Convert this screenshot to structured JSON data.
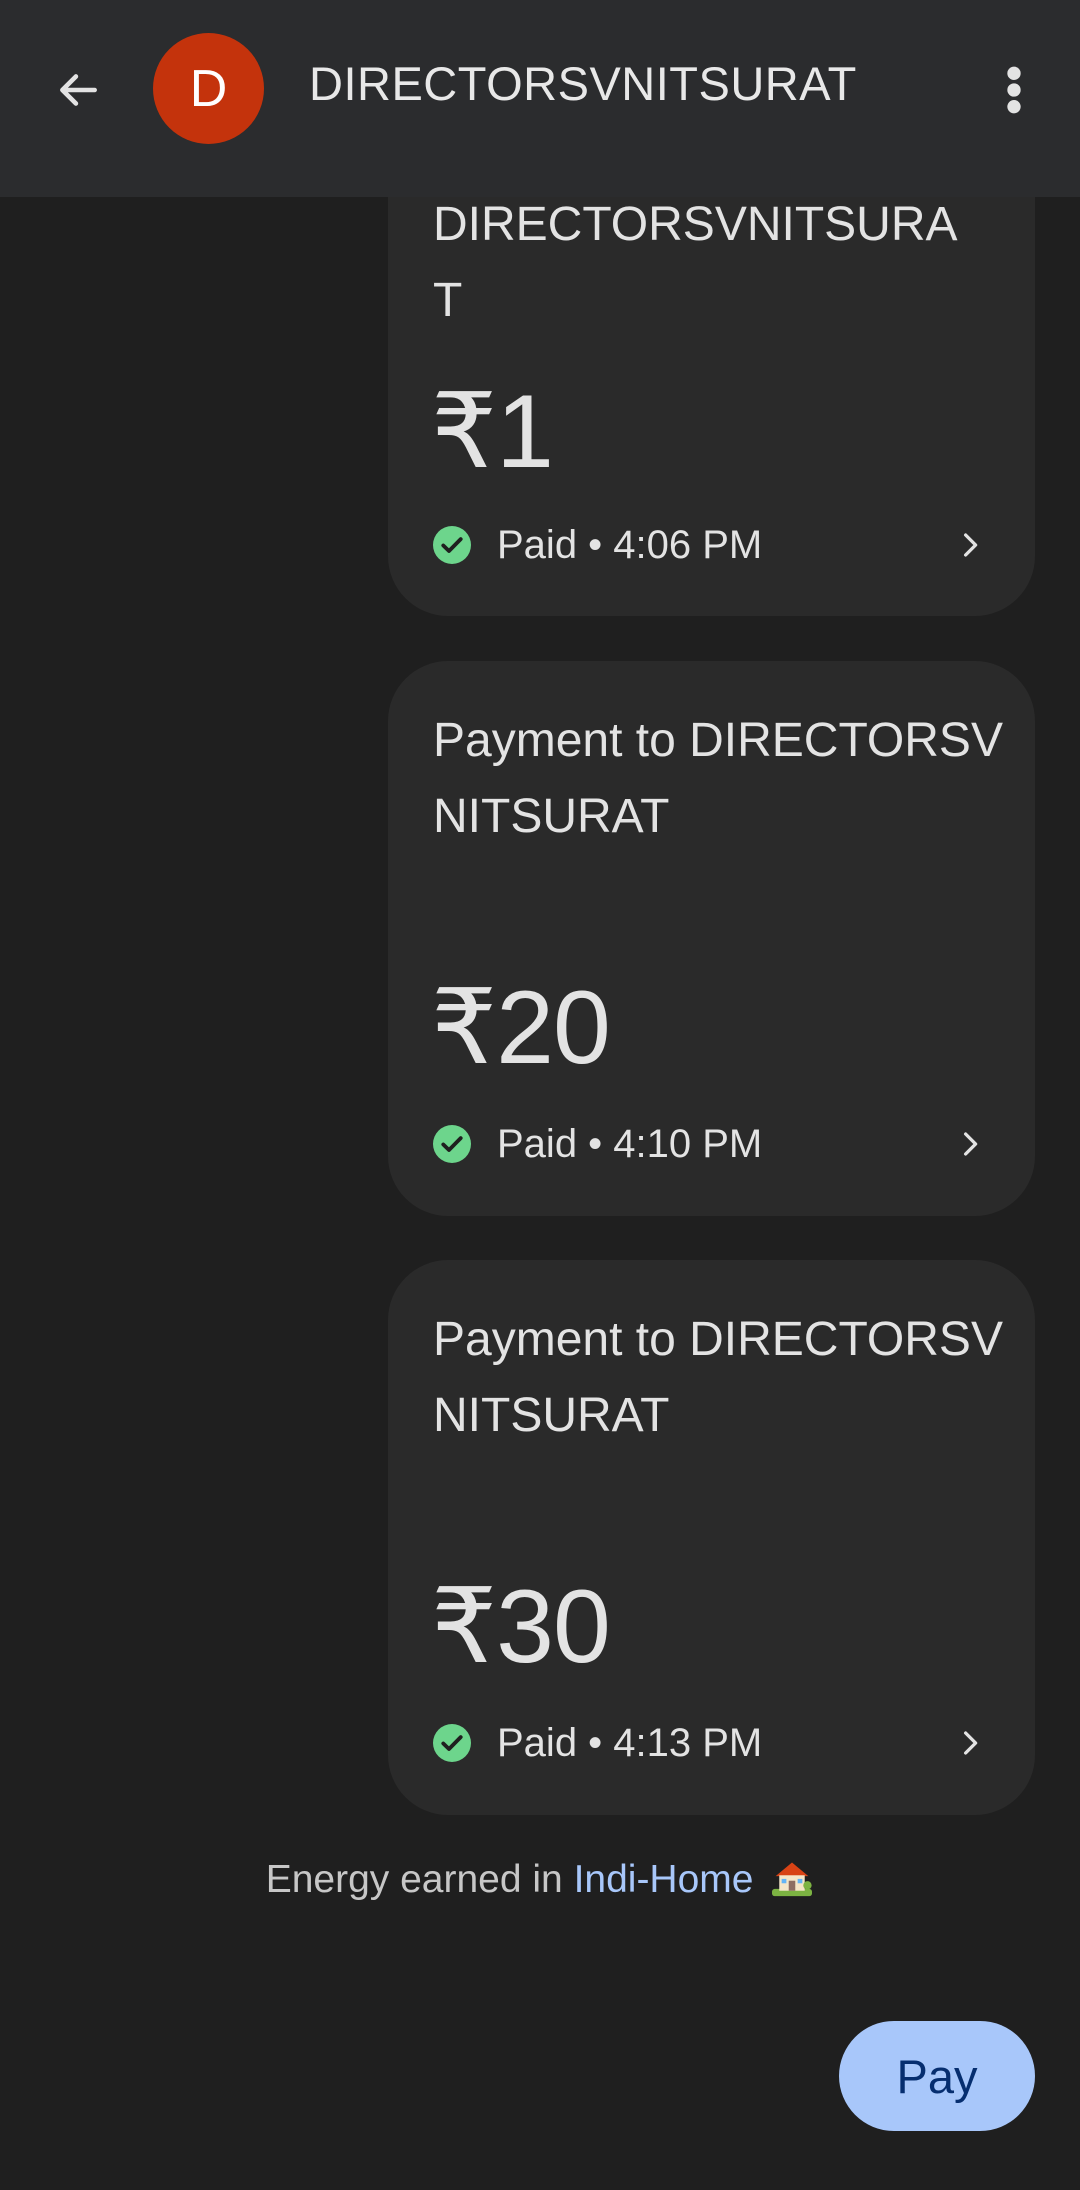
{
  "header": {
    "back_icon": "arrow-back-icon",
    "avatar_letter": "D",
    "avatar_color": "#c4330c",
    "title": "DIRECTORSVNITSURAT",
    "more_icon": "more-vert-icon"
  },
  "payments": [
    {
      "title_visible": "DIRECTORSVNITSURA\nT",
      "amount": "₹1",
      "status": "Paid • 4:06 PM"
    },
    {
      "title": "Payment to DIRECTORSVNITSURAT",
      "amount": "₹20",
      "status": "Paid • 4:10 PM"
    },
    {
      "title": "Payment to DIRECTORSVNITSURAT",
      "amount": "₹30",
      "status": "Paid • 4:13 PM"
    }
  ],
  "footer": {
    "energy_prefix": "Energy earned in ",
    "energy_link": "Indi-Home",
    "energy_icon": "house-icon"
  },
  "pay_button": {
    "label": "Pay",
    "color": "#a8c7fa"
  },
  "colors": {
    "background": "#1f1f1f",
    "card": "#2a2a2a",
    "success": "#6dd58c"
  }
}
